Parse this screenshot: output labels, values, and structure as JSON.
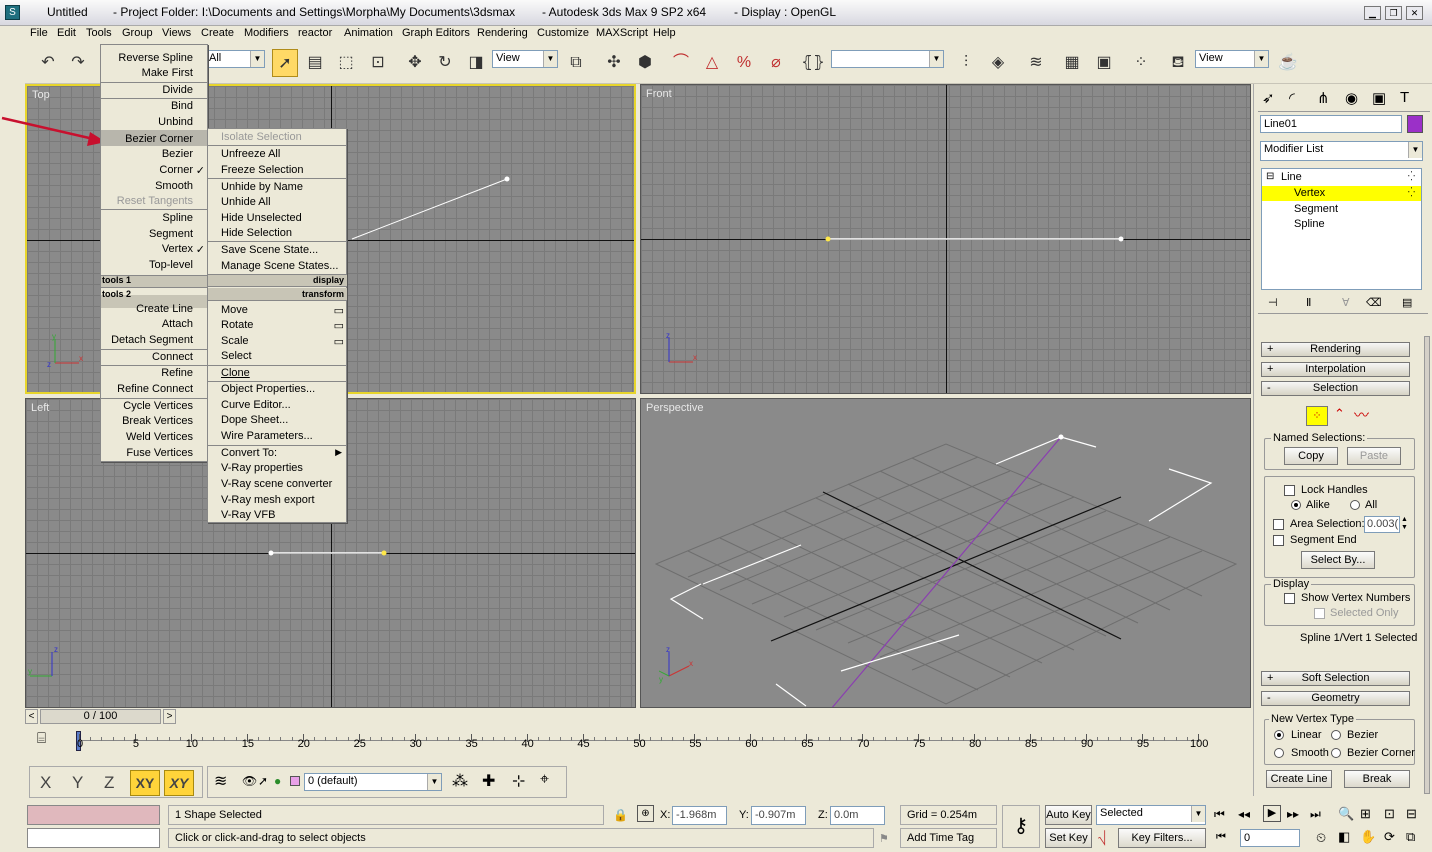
{
  "window": {
    "app_name": "Untitled",
    "folder": "- Project Folder: I:\\Documents and Settings\\Morpha\\My Documents\\3dsmax",
    "product": "- Autodesk 3ds Max 9 SP2 x64",
    "display": "- Display : OpenGL"
  },
  "menubar": [
    "File",
    "Edit",
    "Tools",
    "Group",
    "Views",
    "Create",
    "Modifiers",
    "reactor",
    "Animation",
    "Graph Editors",
    "Rendering",
    "Customize",
    "MAXScript",
    "Help"
  ],
  "toolbar": {
    "selection_filter": "All",
    "ref_coord": "View",
    "named_sel": "",
    "render_view": "View"
  },
  "viewports": {
    "top": "Top",
    "front": "Front",
    "left": "Left",
    "perspective": "Perspective"
  },
  "quad_left": [
    {
      "label": "Reverse Spline"
    },
    {
      "label": "Make First"
    },
    {
      "label": "Divide"
    },
    {
      "label": "Bind"
    },
    {
      "label": "Unbind"
    },
    {
      "label": "Bezier Corner"
    },
    {
      "label": "Bezier"
    },
    {
      "label": "Corner",
      "check": "✓"
    },
    {
      "label": "Smooth"
    },
    {
      "label": "Reset Tangents",
      "disabled": true
    },
    {
      "label": "Spline"
    },
    {
      "label": "Segment"
    },
    {
      "label": "Vertex",
      "check": "✓"
    },
    {
      "label": "Top-level"
    },
    {
      "label": "Create Line"
    },
    {
      "label": "Attach"
    },
    {
      "label": "Detach Segment"
    },
    {
      "label": "Connect"
    },
    {
      "label": "Refine"
    },
    {
      "label": "Refine Connect"
    },
    {
      "label": "Cycle Vertices"
    },
    {
      "label": "Break Vertices"
    },
    {
      "label": "Weld Vertices"
    },
    {
      "label": "Fuse Vertices"
    }
  ],
  "quad_headers": {
    "tools1": "tools 1",
    "display": "display",
    "tools2": "tools 2",
    "transform": "transform"
  },
  "quad_right": [
    {
      "label": "Isolate Selection",
      "disabled": true
    },
    {
      "label": "Unfreeze All"
    },
    {
      "label": "Freeze Selection"
    },
    {
      "label": "Unhide by Name"
    },
    {
      "label": "Unhide All"
    },
    {
      "label": "Hide Unselected"
    },
    {
      "label": "Hide Selection"
    },
    {
      "label": "Save Scene State..."
    },
    {
      "label": "Manage Scene States..."
    },
    {
      "label": "Move"
    },
    {
      "label": "Rotate"
    },
    {
      "label": "Scale"
    },
    {
      "label": "Select"
    },
    {
      "label": "Clone"
    },
    {
      "label": "Object Properties..."
    },
    {
      "label": "Curve Editor..."
    },
    {
      "label": "Dope Sheet..."
    },
    {
      "label": "Wire Parameters..."
    },
    {
      "label": "Convert To:"
    },
    {
      "label": "V-Ray properties"
    },
    {
      "label": "V-Ray scene converter"
    },
    {
      "label": "V-Ray mesh export"
    },
    {
      "label": "V-Ray VFB"
    }
  ],
  "cmd": {
    "object_name": "Line01",
    "object_color": "#9b30c8",
    "modifier_list": "Modifier List",
    "stack": [
      "Line",
      "Vertex",
      "Segment",
      "Spline"
    ],
    "rollouts": {
      "rendering": "Rendering",
      "interpolation": "Interpolation",
      "selection": "Selection",
      "soft": "Soft Selection",
      "geometry": "Geometry"
    },
    "named_selections": "Named Selections:",
    "copy": "Copy",
    "paste": "Paste",
    "lock_handles": "Lock Handles",
    "alike": "Alike",
    "all": "All",
    "area_selection": "Area Selection:",
    "area_value": "0.003(",
    "segment_end": "Segment End",
    "select_by": "Select By...",
    "display": "Display",
    "show_vertex_numbers": "Show Vertex Numbers",
    "selected_only": "Selected Only",
    "status": "Spline 1/Vert 1 Selected",
    "new_vertex_type": "New Vertex Type",
    "linear": "Linear",
    "bezier": "Bezier",
    "smooth": "Smooth",
    "bezier_corner": "Bezier Corner",
    "create_line": "Create Line",
    "break": "Break"
  },
  "timeline": {
    "frame": "0 / 100",
    "ticks": [
      "0",
      "5",
      "10",
      "15",
      "20",
      "25",
      "30",
      "35",
      "40",
      "45",
      "50",
      "55",
      "60",
      "65",
      "70",
      "75",
      "80",
      "85",
      "90",
      "95",
      "100"
    ]
  },
  "axis_buttons": [
    "X",
    "Y",
    "Z",
    "XY",
    "XY"
  ],
  "layer": "0 (default)",
  "status": {
    "shape": "1 Shape Selected",
    "prompt": "Click or click-and-drag to select objects",
    "x_label": "X:",
    "x": "-1.968m",
    "y_label": "Y:",
    "y": "-0.907m",
    "z_label": "Z:",
    "z": "0.0m",
    "grid": "Grid = 0.254m",
    "add_time_tag": "Add Time Tag",
    "auto_key": "Auto Key",
    "set_key": "Set Key",
    "selected": "Selected",
    "key_filters": "Key Filters...",
    "frame_field": "0"
  }
}
